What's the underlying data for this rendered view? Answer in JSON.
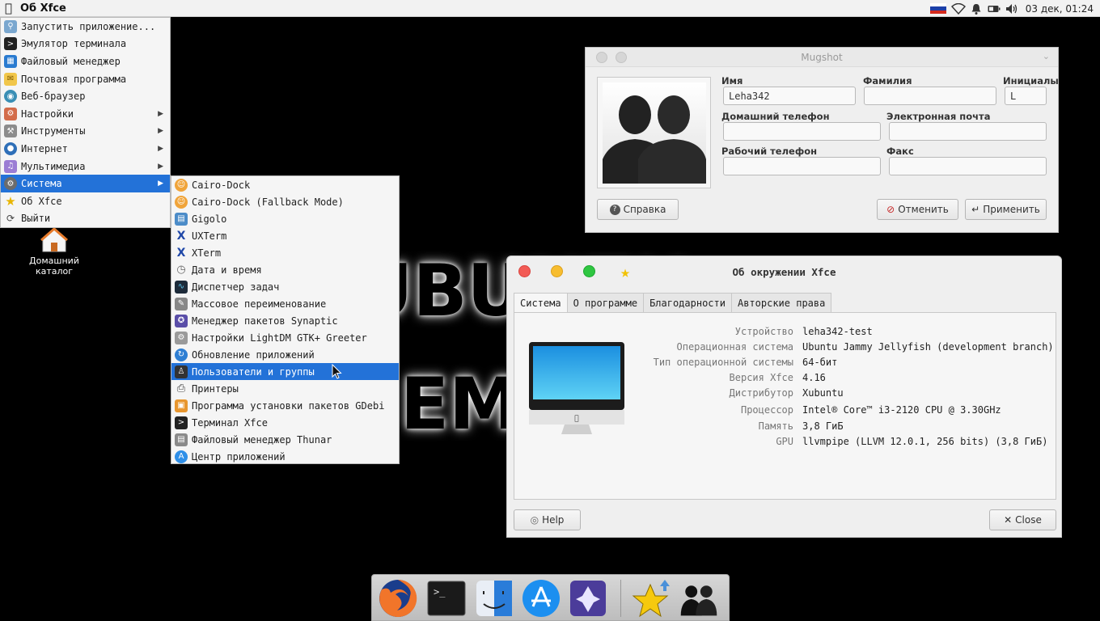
{
  "top_panel": {
    "app_title": "Об Xfce",
    "clock": "03 дек, 01:24",
    "tray_icons": [
      "russian-flag-icon",
      "wifi-icon",
      "bell-icon",
      "battery-icon",
      "volume-icon"
    ],
    "flag_colors": [
      "#ffffff",
      "#1c3fa8",
      "#d52b1e"
    ]
  },
  "main_menu": {
    "items": [
      {
        "label": "Запустить приложение...",
        "icon": "search-icon",
        "submenu": false
      },
      {
        "label": "Эмулятор терминала",
        "icon": "terminal-icon",
        "submenu": false
      },
      {
        "label": "Файловый менеджер",
        "icon": "file-manager-icon",
        "submenu": false
      },
      {
        "label": "Почтовая программа",
        "icon": "mail-icon",
        "submenu": false
      },
      {
        "label": "Веб-браузер",
        "icon": "globe-icon",
        "submenu": false
      },
      {
        "label": "Настройки",
        "icon": "settings-icon",
        "submenu": true
      },
      {
        "label": "Инструменты",
        "icon": "tools-icon",
        "submenu": true
      },
      {
        "label": "Интернет",
        "icon": "internet-icon",
        "submenu": true
      },
      {
        "label": "Мультимедиа",
        "icon": "multimedia-icon",
        "submenu": true
      },
      {
        "label": "Система",
        "icon": "system-icon",
        "submenu": true,
        "selected": true
      },
      {
        "label": "Об Xfce",
        "icon": "star-icon",
        "submenu": false
      },
      {
        "label": "Выйти",
        "icon": "logout-icon",
        "submenu": false
      }
    ]
  },
  "sub_menu": {
    "items": [
      {
        "label": "Cairo-Dock",
        "icon": "cairo-dock-icon"
      },
      {
        "label": "Cairo-Dock (Fallback Mode)",
        "icon": "cairo-dock-icon"
      },
      {
        "label": "Gigolo",
        "icon": "gigolo-icon"
      },
      {
        "label": "UXTerm",
        "icon": "xterm-icon"
      },
      {
        "label": "XTerm",
        "icon": "xterm-icon"
      },
      {
        "label": "Дата и время",
        "icon": "clock-icon"
      },
      {
        "label": "Диспетчер задач",
        "icon": "task-manager-icon"
      },
      {
        "label": "Массовое переименование",
        "icon": "rename-icon"
      },
      {
        "label": "Менеджер пакетов Synaptic",
        "icon": "synaptic-icon"
      },
      {
        "label": "Настройки LightDM GTK+ Greeter",
        "icon": "lightdm-icon"
      },
      {
        "label": "Обновление приложений",
        "icon": "update-icon"
      },
      {
        "label": "Пользователи и группы",
        "icon": "users-icon",
        "selected": true
      },
      {
        "label": "Принтеры",
        "icon": "printer-icon"
      },
      {
        "label": "Программа установки пакетов GDebi",
        "icon": "gdebi-icon"
      },
      {
        "label": "Терминал Xfce",
        "icon": "terminal-icon"
      },
      {
        "label": "Файловый менеджер Thunar",
        "icon": "thunar-icon"
      },
      {
        "label": "Центр приложений",
        "icon": "app-center-icon"
      }
    ]
  },
  "desktop": {
    "home_label": "Домашний каталог",
    "watermark_line1": "UBUNTU",
    "watermark_line2": "EM"
  },
  "mugshot": {
    "title": "Mugshot",
    "labels": {
      "first_name": "Имя",
      "last_name": "Фамилия",
      "initials": "Инициалы",
      "home_phone": "Домашний телефон",
      "email": "Электронная почта",
      "work_phone": "Рабочий телефон",
      "fax": "Факс"
    },
    "values": {
      "first_name": "Leha342",
      "last_name": "",
      "initials": "L",
      "home_phone": "",
      "email": "",
      "work_phone": "",
      "fax": ""
    },
    "buttons": {
      "help": "Справка",
      "cancel": "Отменить",
      "apply": "Применить"
    }
  },
  "about": {
    "title": "Об окружении Xfce",
    "tabs": [
      "Система",
      "О программе",
      "Благодарности",
      "Авторские права"
    ],
    "active_tab": "Система",
    "info": [
      {
        "key": "Устройство",
        "value": "leha342-test"
      },
      {
        "key": "Операционная система",
        "value": "Ubuntu Jammy Jellyfish (development branch)"
      },
      {
        "key": "Тип операционной системы",
        "value": "64-бит"
      },
      {
        "key": "Версия Xfce",
        "value": "4.16"
      },
      {
        "key": "Дистрибутор",
        "value": "Xubuntu"
      },
      {
        "key": "Процессор",
        "value": "Intel® Core™ i3-2120 CPU @ 3.30GHz"
      },
      {
        "key": "Память",
        "value": "3,8 ГиБ"
      },
      {
        "key": "GPU",
        "value": "llvmpipe (LLVM 12.0.1, 256 bits) (3,8 ГиБ)"
      }
    ],
    "buttons": {
      "help": "Help",
      "close": "Close"
    },
    "traffic_light_colors": [
      "#f25b55",
      "#f7bd2f",
      "#2fc641"
    ]
  },
  "dock": {
    "items": [
      "firefox-icon",
      "terminal-icon",
      "finder-icon",
      "app-store-icon",
      "synaptic-icon",
      "favorites-icon",
      "users-icon"
    ]
  }
}
